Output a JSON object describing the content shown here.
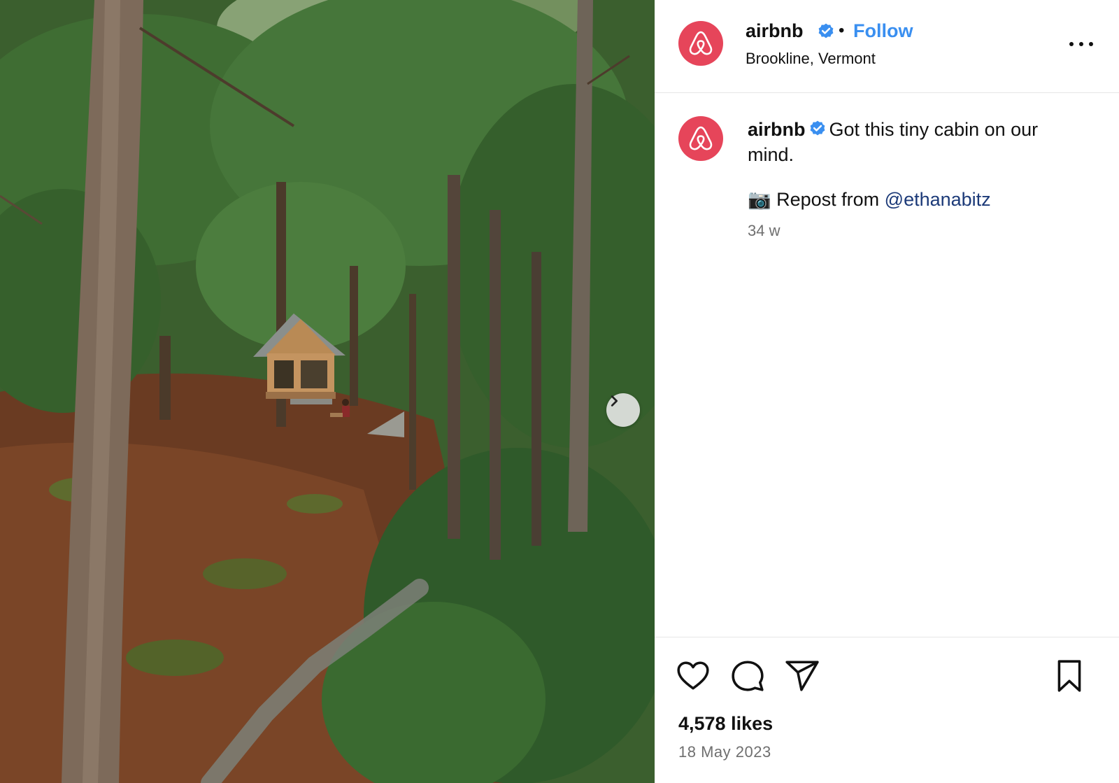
{
  "post": {
    "image_alt": "Tiny wooden cabin in a pine forest",
    "account": {
      "username": "airbnb",
      "verified": true,
      "follow_label": "Follow",
      "location": "Brookline, Vermont",
      "separator": "•"
    },
    "caption": {
      "username": "airbnb",
      "text": "Got this tiny cabin on our mind.",
      "repost_prefix": "📷 Repost from ",
      "mention": "@ethanabitz",
      "time_ago": "34 w"
    },
    "stats": {
      "likes": "4,578 likes",
      "date": "18 May 2023"
    }
  },
  "colors": {
    "brand": "#e6455a",
    "follow": "#3a8ff0",
    "mention": "#1c3a78",
    "muted": "#6f6f6f"
  },
  "icons": {
    "logo": "airbnb-logo-icon",
    "verified": "verified-badge-icon",
    "more": "more-options-icon",
    "next": "chevron-right-icon",
    "like": "heart-icon",
    "comment": "comment-icon",
    "share": "send-icon",
    "save": "bookmark-icon"
  }
}
